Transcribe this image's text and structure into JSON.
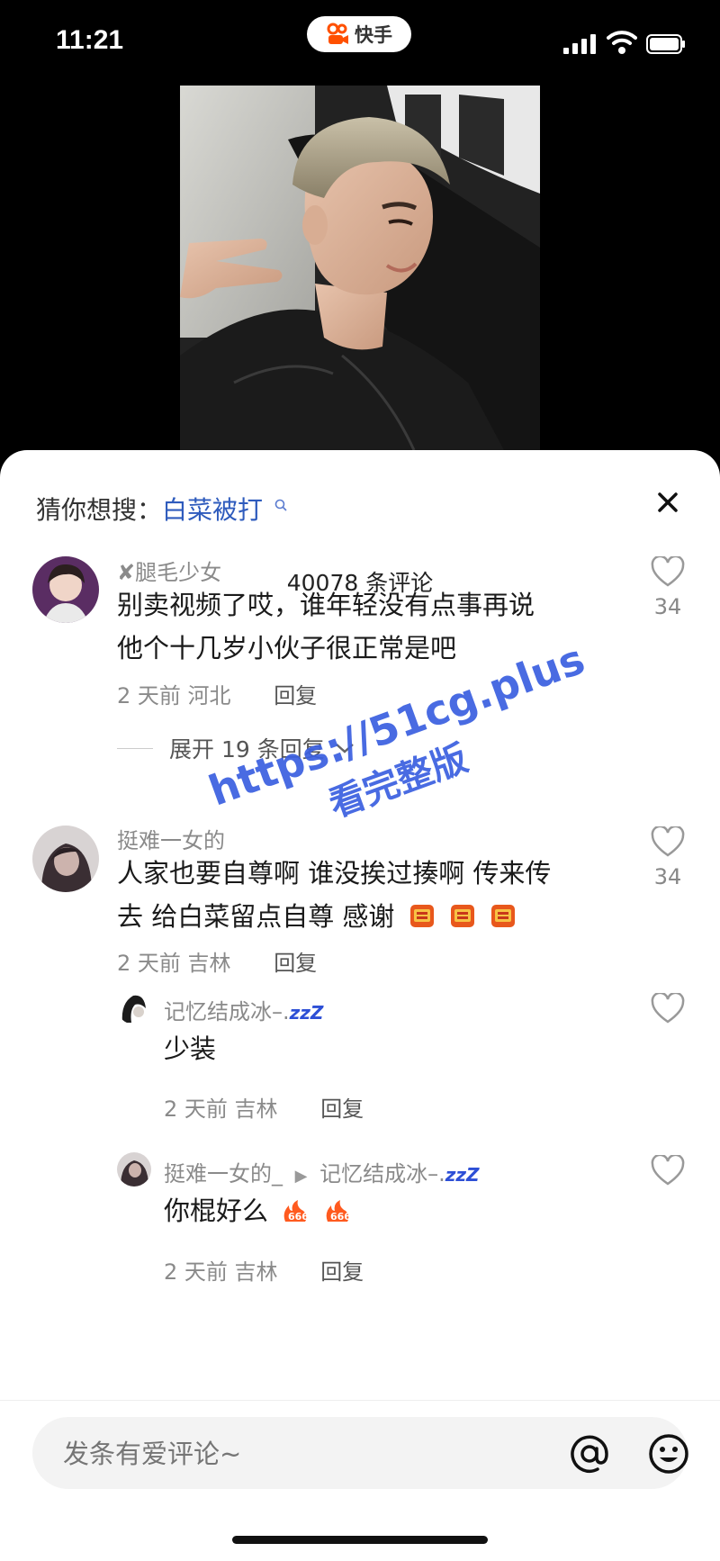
{
  "status": {
    "time": "11:21",
    "app_name": "快手"
  },
  "search_suggest": {
    "label": "猜你想搜：",
    "keyword": "白菜被打"
  },
  "comment_count": "40078 条评论",
  "comments": [
    {
      "user": "✘腿毛少女",
      "line1": "别卖视频了哎，谁年轻没有点事再说",
      "line2": "他个十几岁小伙子很正常是吧",
      "time": "2 天前",
      "location": "河北",
      "reply_label": "回复",
      "likes": "34",
      "expand_label": "展开 19 条回复"
    },
    {
      "user": "挺难一女的",
      "line1": "人家也要自尊啊 谁没挨过揍啊 传来传",
      "line2": "去 给白菜留点自尊 感谢",
      "time": "2 天前",
      "location": "吉林",
      "reply_label": "回复",
      "likes": "34"
    }
  ],
  "replies": [
    {
      "user": "记忆结成冰–.",
      "zz": "zzZ",
      "text": "少装",
      "time": "2 天前",
      "location": "吉林",
      "reply_label": "回复"
    },
    {
      "user": "挺难一女的_",
      "reply_to": "记忆结成冰–.",
      "zz": "zzZ",
      "text": "你棍好么",
      "time": "2 天前",
      "location": "吉林",
      "reply_label": "回复"
    }
  ],
  "watermark": {
    "line1": "https://51cg.plus",
    "line2": "看完整版"
  },
  "input": {
    "placeholder": "发条有爱评论~"
  },
  "icons": [
    "kuaishou-logo",
    "signal-icon",
    "wifi-icon",
    "battery-icon",
    "search-icon",
    "close-icon",
    "heart-icon",
    "chevron-down-icon",
    "at-icon",
    "emoji-icon",
    "fire-emoji"
  ],
  "colors": {
    "accent_link": "#2e5bbd",
    "watermark": "#3a5fe0",
    "zz": "#2d4fd6"
  }
}
